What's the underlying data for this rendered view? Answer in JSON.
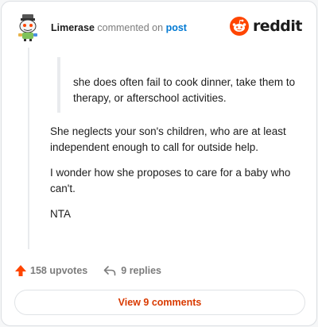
{
  "header": {
    "username": "Limerase",
    "action": "commented on",
    "post_link": "post",
    "logo_text": "reddit"
  },
  "comment": {
    "quote": "she does often fail to cook dinner, take them to therapy, or afterschool activities.",
    "paragraphs": [
      "She neglects your son's children, who are at least independent enough to call for outside help.",
      "I wonder how she proposes to care for a baby who can't.",
      "NTA"
    ]
  },
  "footer": {
    "upvotes": "158 upvotes",
    "replies": "9 replies"
  },
  "view_button": "View 9 comments",
  "colors": {
    "brand_orange": "#ff4500",
    "link_blue": "#0079d3",
    "view_button_text": "#d93a00",
    "upvote_arrow": "#ff4500"
  },
  "icons": {
    "avatar": "snoo-avatar-icon",
    "logo": "reddit-snoo-icon",
    "upvote": "upvote-arrow-icon",
    "reply": "reply-arrow-icon"
  }
}
